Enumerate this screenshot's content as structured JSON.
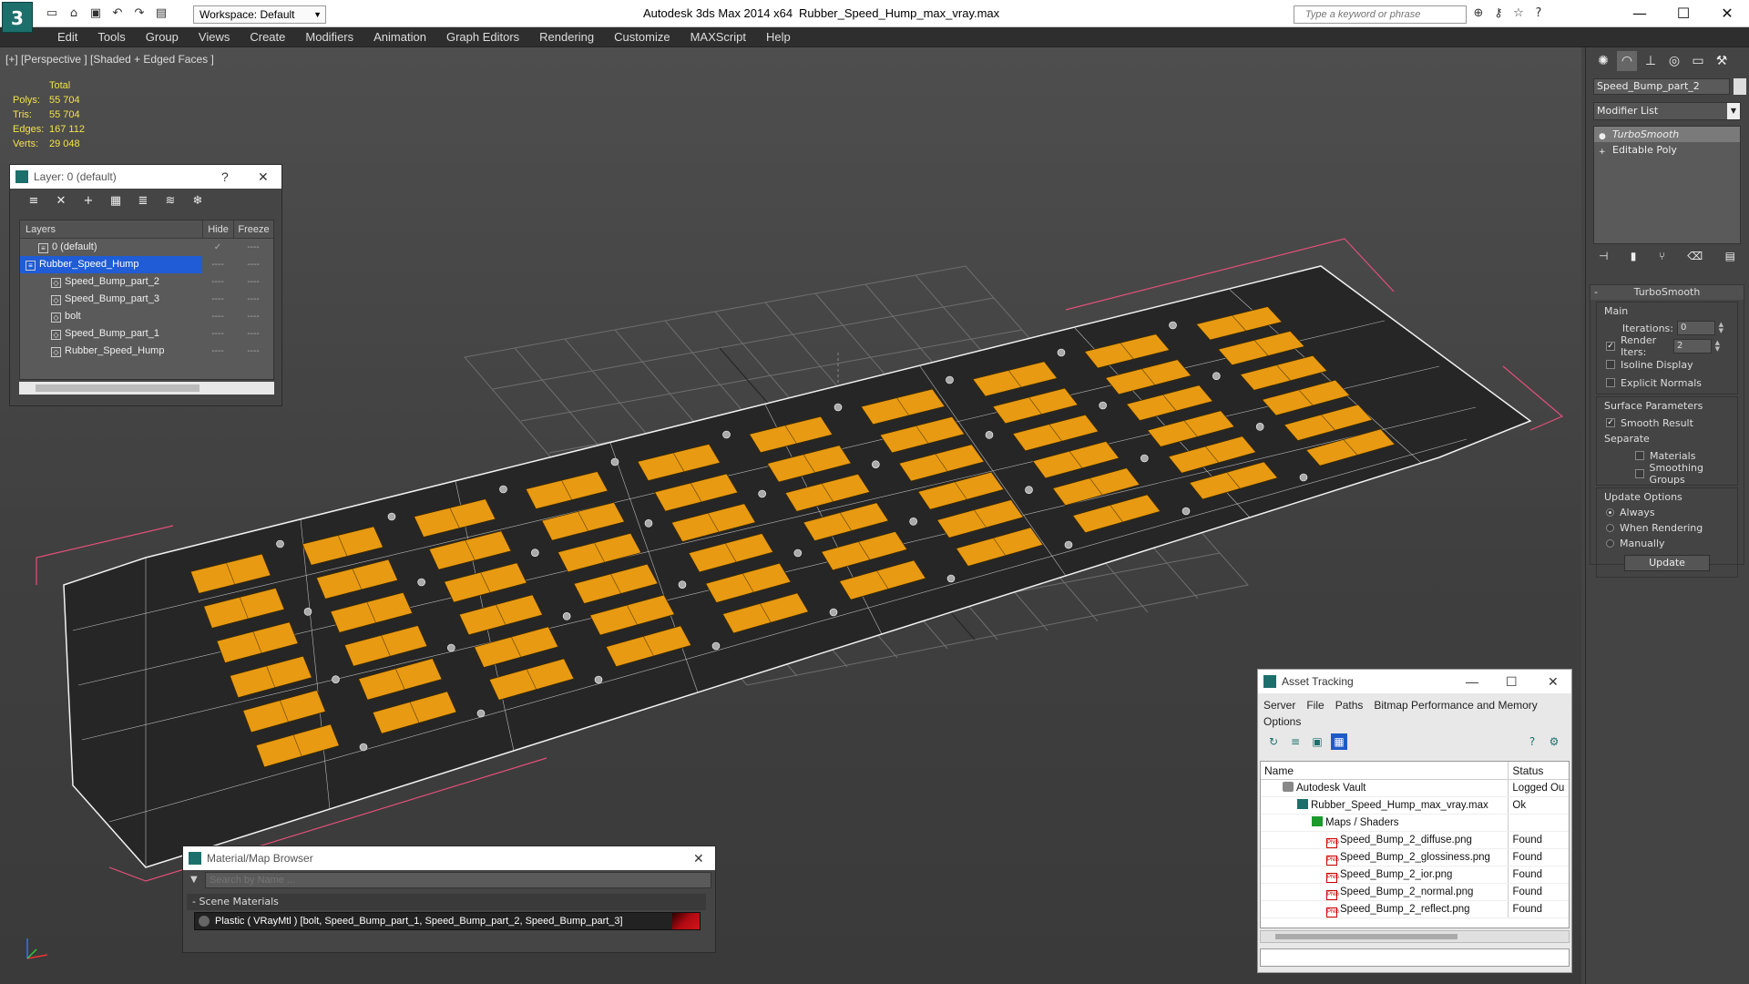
{
  "title_bar": {
    "logo": "3",
    "workspace": "Workspace: Default",
    "app_title": "Autodesk 3ds Max  2014 x64",
    "file_name": "Rubber_Speed_Hump_max_vray.max",
    "search_placeholder": "Type a keyword or phrase"
  },
  "menu": [
    "Edit",
    "Tools",
    "Group",
    "Views",
    "Create",
    "Modifiers",
    "Animation",
    "Graph Editors",
    "Rendering",
    "Customize",
    "MAXScript",
    "Help"
  ],
  "viewport": {
    "label": "[+] [Perspective ] [Shaded + Edged Faces ]",
    "stats": {
      "header": "Total",
      "rows": [
        {
          "key": "Polys:",
          "value": "55 704"
        },
        {
          "key": "Tris:",
          "value": "55 704"
        },
        {
          "key": "Edges:",
          "value": "167 112"
        },
        {
          "key": "Verts:",
          "value": "29 048"
        }
      ]
    },
    "colors": {
      "pad": "#e89a12",
      "wire": "#ffffff",
      "selection": "#e0507a",
      "grid": "#7a7a7a"
    }
  },
  "layer_window": {
    "title": "Layer: 0 (default)",
    "help": "?",
    "close": "✕",
    "columns": {
      "layers": "Layers",
      "hide": "Hide",
      "freeze": "Freeze"
    },
    "rows": [
      {
        "name": "0 (default)",
        "hide": "✓",
        "freeze": "----"
      },
      {
        "name": "Rubber_Speed_Hump",
        "hide": "----",
        "freeze": "----"
      },
      {
        "name": "Speed_Bump_part_2",
        "hide": "----",
        "freeze": "----"
      },
      {
        "name": "Speed_Bump_part_3",
        "hide": "----",
        "freeze": "----"
      },
      {
        "name": "bolt",
        "hide": "----",
        "freeze": "----"
      },
      {
        "name": "Speed_Bump_part_1",
        "hide": "----",
        "freeze": "----"
      },
      {
        "name": "Rubber_Speed_Hump",
        "hide": "----",
        "freeze": "----"
      }
    ]
  },
  "command_panel": {
    "object_name": "Speed_Bump_part_2",
    "modifier_list": "Modifier List",
    "stack": [
      "TurboSmooth",
      "Editable Poly"
    ],
    "turbosmooth": {
      "title": "TurboSmooth",
      "main": "Main",
      "iterations_label": "Iterations:",
      "iterations": "0",
      "render_iters_label": "Render Iters:",
      "render_iters": "2",
      "isoline": "Isoline Display",
      "explicit_normals": "Explicit Normals",
      "surface_params": "Surface Parameters",
      "smooth_result": "Smooth Result",
      "separate": "Separate",
      "materials": "Materials",
      "smoothing_groups": "Smoothing Groups",
      "update_options": "Update Options",
      "always": "Always",
      "when_rendering": "When Rendering",
      "manually": "Manually",
      "update": "Update"
    }
  },
  "material_browser": {
    "title": "Material/Map Browser",
    "search_placeholder": "Search by Name ...",
    "section": "- Scene Materials",
    "material": "Plastic  ( VRayMtl ) [bolt, Speed_Bump_part_1, Speed_Bump_part_2, Speed_Bump_part_3]"
  },
  "asset_tracking": {
    "title": "Asset Tracking",
    "menu": [
      "Server",
      "File",
      "Paths",
      "Bitmap Performance and Memory",
      "Options"
    ],
    "columns": {
      "name": "Name",
      "status": "Status"
    },
    "rows": [
      {
        "name": "Autodesk Vault",
        "status": "Logged Ou",
        "indent": 1,
        "icon": "vault"
      },
      {
        "name": "Rubber_Speed_Hump_max_vray.max",
        "status": "Ok",
        "indent": 2,
        "icon": "max"
      },
      {
        "name": "Maps / Shaders",
        "status": "",
        "indent": 3,
        "icon": "maps"
      },
      {
        "name": "Speed_Bump_2_diffuse.png",
        "status": "Found",
        "indent": 4,
        "icon": "png"
      },
      {
        "name": "Speed_Bump_2_glossiness.png",
        "status": "Found",
        "indent": 4,
        "icon": "png"
      },
      {
        "name": "Speed_Bump_2_ior.png",
        "status": "Found",
        "indent": 4,
        "icon": "png"
      },
      {
        "name": "Speed_Bump_2_normal.png",
        "status": "Found",
        "indent": 4,
        "icon": "png"
      },
      {
        "name": "Speed_Bump_2_reflect.png",
        "status": "Found",
        "indent": 4,
        "icon": "png"
      }
    ]
  }
}
